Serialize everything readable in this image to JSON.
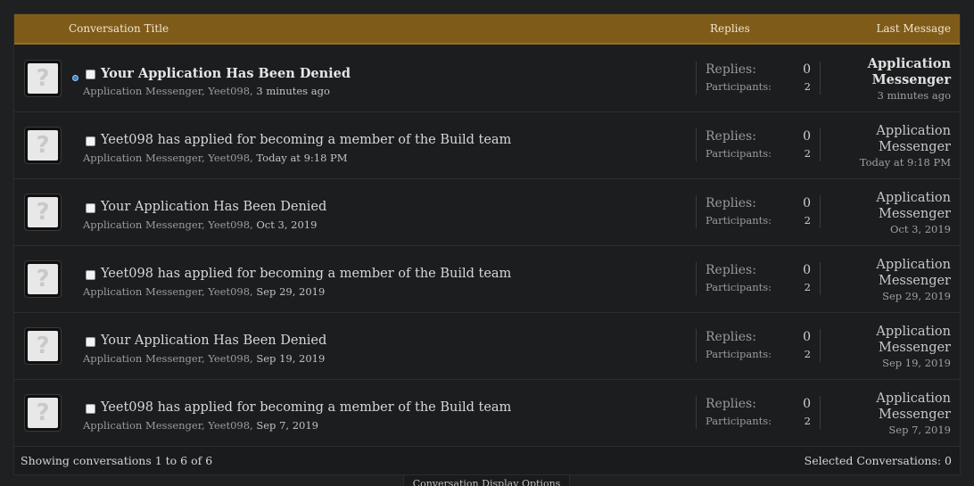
{
  "header": {
    "title_col": "Conversation Title",
    "replies_col": "Replies",
    "last_col": "Last Message"
  },
  "labels": {
    "replies": "Replies:",
    "participants": "Participants:"
  },
  "conversations": [
    {
      "title": "Your Application Has Been Denied",
      "starters": "Application Messenger, Yeet098, ",
      "date": "3 minutes ago",
      "replies": "0",
      "participants": "2",
      "last_line1": "Application",
      "last_line2": "Messenger",
      "last_when": "3 minutes ago",
      "unread": true
    },
    {
      "title": "Yeet098 has applied for becoming a member of the Build team",
      "starters": "Application Messenger, Yeet098, ",
      "date": "Today at 9:18 PM",
      "replies": "0",
      "participants": "2",
      "last_line1": "Application",
      "last_line2": "Messenger",
      "last_when": "Today at 9:18 PM",
      "unread": false
    },
    {
      "title": "Your Application Has Been Denied",
      "starters": "Application Messenger, Yeet098, ",
      "date": "Oct 3, 2019",
      "replies": "0",
      "participants": "2",
      "last_line1": "Application",
      "last_line2": "Messenger",
      "last_when": "Oct 3, 2019",
      "unread": false
    },
    {
      "title": "Yeet098 has applied for becoming a member of the Build team",
      "starters": "Application Messenger, Yeet098, ",
      "date": "Sep 29, 2019",
      "replies": "0",
      "participants": "2",
      "last_line1": "Application",
      "last_line2": "Messenger",
      "last_when": "Sep 29, 2019",
      "unread": false
    },
    {
      "title": "Your Application Has Been Denied",
      "starters": "Application Messenger, Yeet098, ",
      "date": "Sep 19, 2019",
      "replies": "0",
      "participants": "2",
      "last_line1": "Application",
      "last_line2": "Messenger",
      "last_when": "Sep 19, 2019",
      "unread": false
    },
    {
      "title": "Yeet098 has applied for becoming a member of the Build team",
      "starters": "Application Messenger, Yeet098, ",
      "date": "Sep 7, 2019",
      "replies": "0",
      "participants": "2",
      "last_line1": "Application",
      "last_line2": "Messenger",
      "last_when": "Sep 7, 2019",
      "unread": false
    }
  ],
  "avatar_glyph": "?",
  "footer": {
    "showing": "Showing conversations 1 to 6 of 6",
    "selected": "Selected Conversations: 0"
  },
  "options_tab": "Conversation Display Options",
  "colors": {
    "header_bar": "#7f5b1a",
    "unread_dot": "#3b83c9",
    "background": "#1f2021"
  }
}
